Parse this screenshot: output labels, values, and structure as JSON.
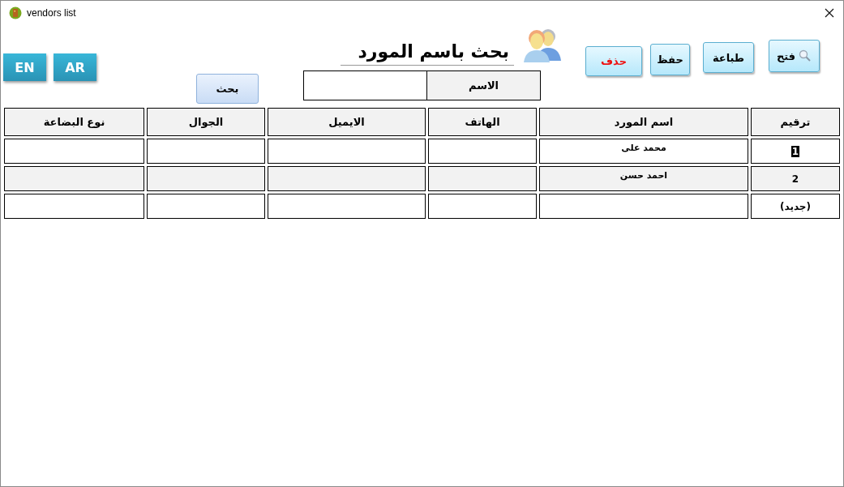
{
  "window": {
    "title": "vendors list"
  },
  "language_buttons": [
    {
      "label": "AR"
    },
    {
      "label": "EN"
    }
  ],
  "search_button": {
    "label": "بحث"
  },
  "heading": "بحث باسم المورد",
  "name_filter": {
    "label": "الاسم"
  },
  "actions": [
    {
      "label": "فتح",
      "kind": "open"
    },
    {
      "label": "طباعة",
      "kind": "plain"
    },
    {
      "label": "حفظ",
      "kind": "plain"
    },
    {
      "label": "حذف",
      "kind": "danger"
    }
  ],
  "table": {
    "columns": [
      "ترقيم",
      "اسم المورد",
      "الهاتف",
      "الايميل",
      "الجوال",
      "نوع البضاعة"
    ],
    "rows": [
      {
        "number": "1",
        "name": "محمد على",
        "selected": true
      },
      {
        "number": "2",
        "name": "احمد حسن",
        "selected": false
      },
      {
        "number": "(جديد)",
        "selected": false
      }
    ]
  }
}
